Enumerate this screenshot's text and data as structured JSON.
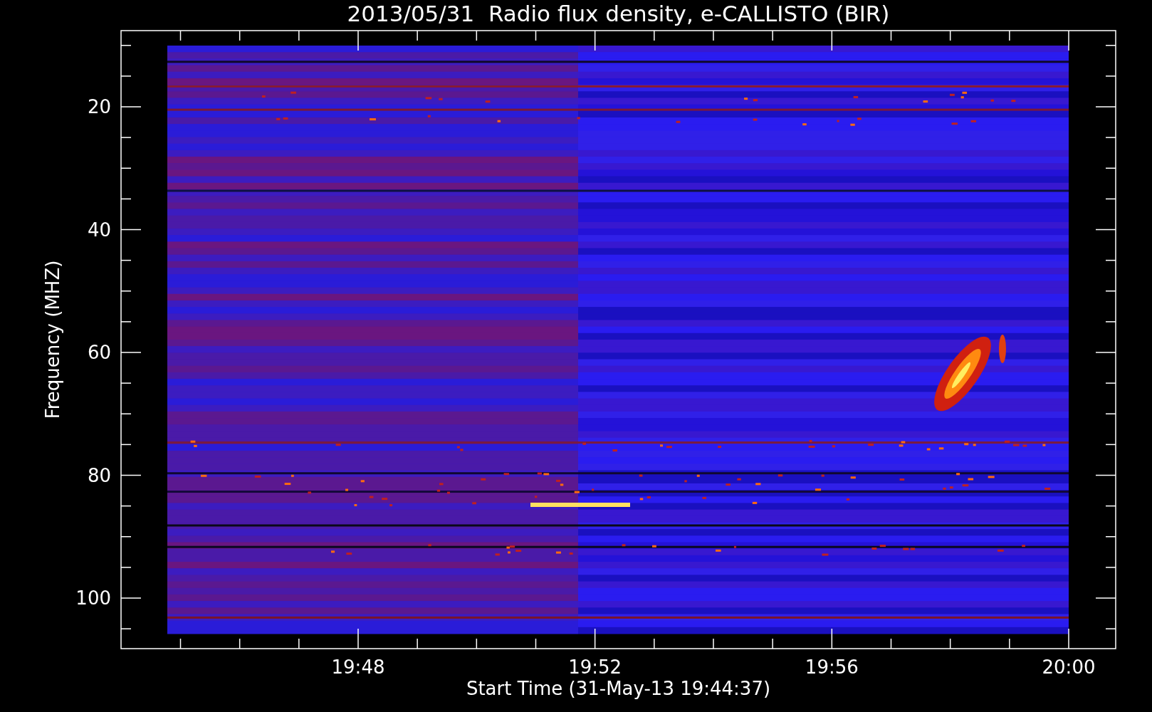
{
  "title": "2013/05/31  Radio flux density, e-CALLISTO (BIR)",
  "ylabel": "Frequency (MHZ)",
  "xlabel": "Start Time (31-May-13 19:44:37)",
  "yticks": [
    "20",
    "40",
    "60",
    "80",
    "100"
  ],
  "xticks": [
    "19:48",
    "19:52",
    "19:56",
    "20:00"
  ]
}
